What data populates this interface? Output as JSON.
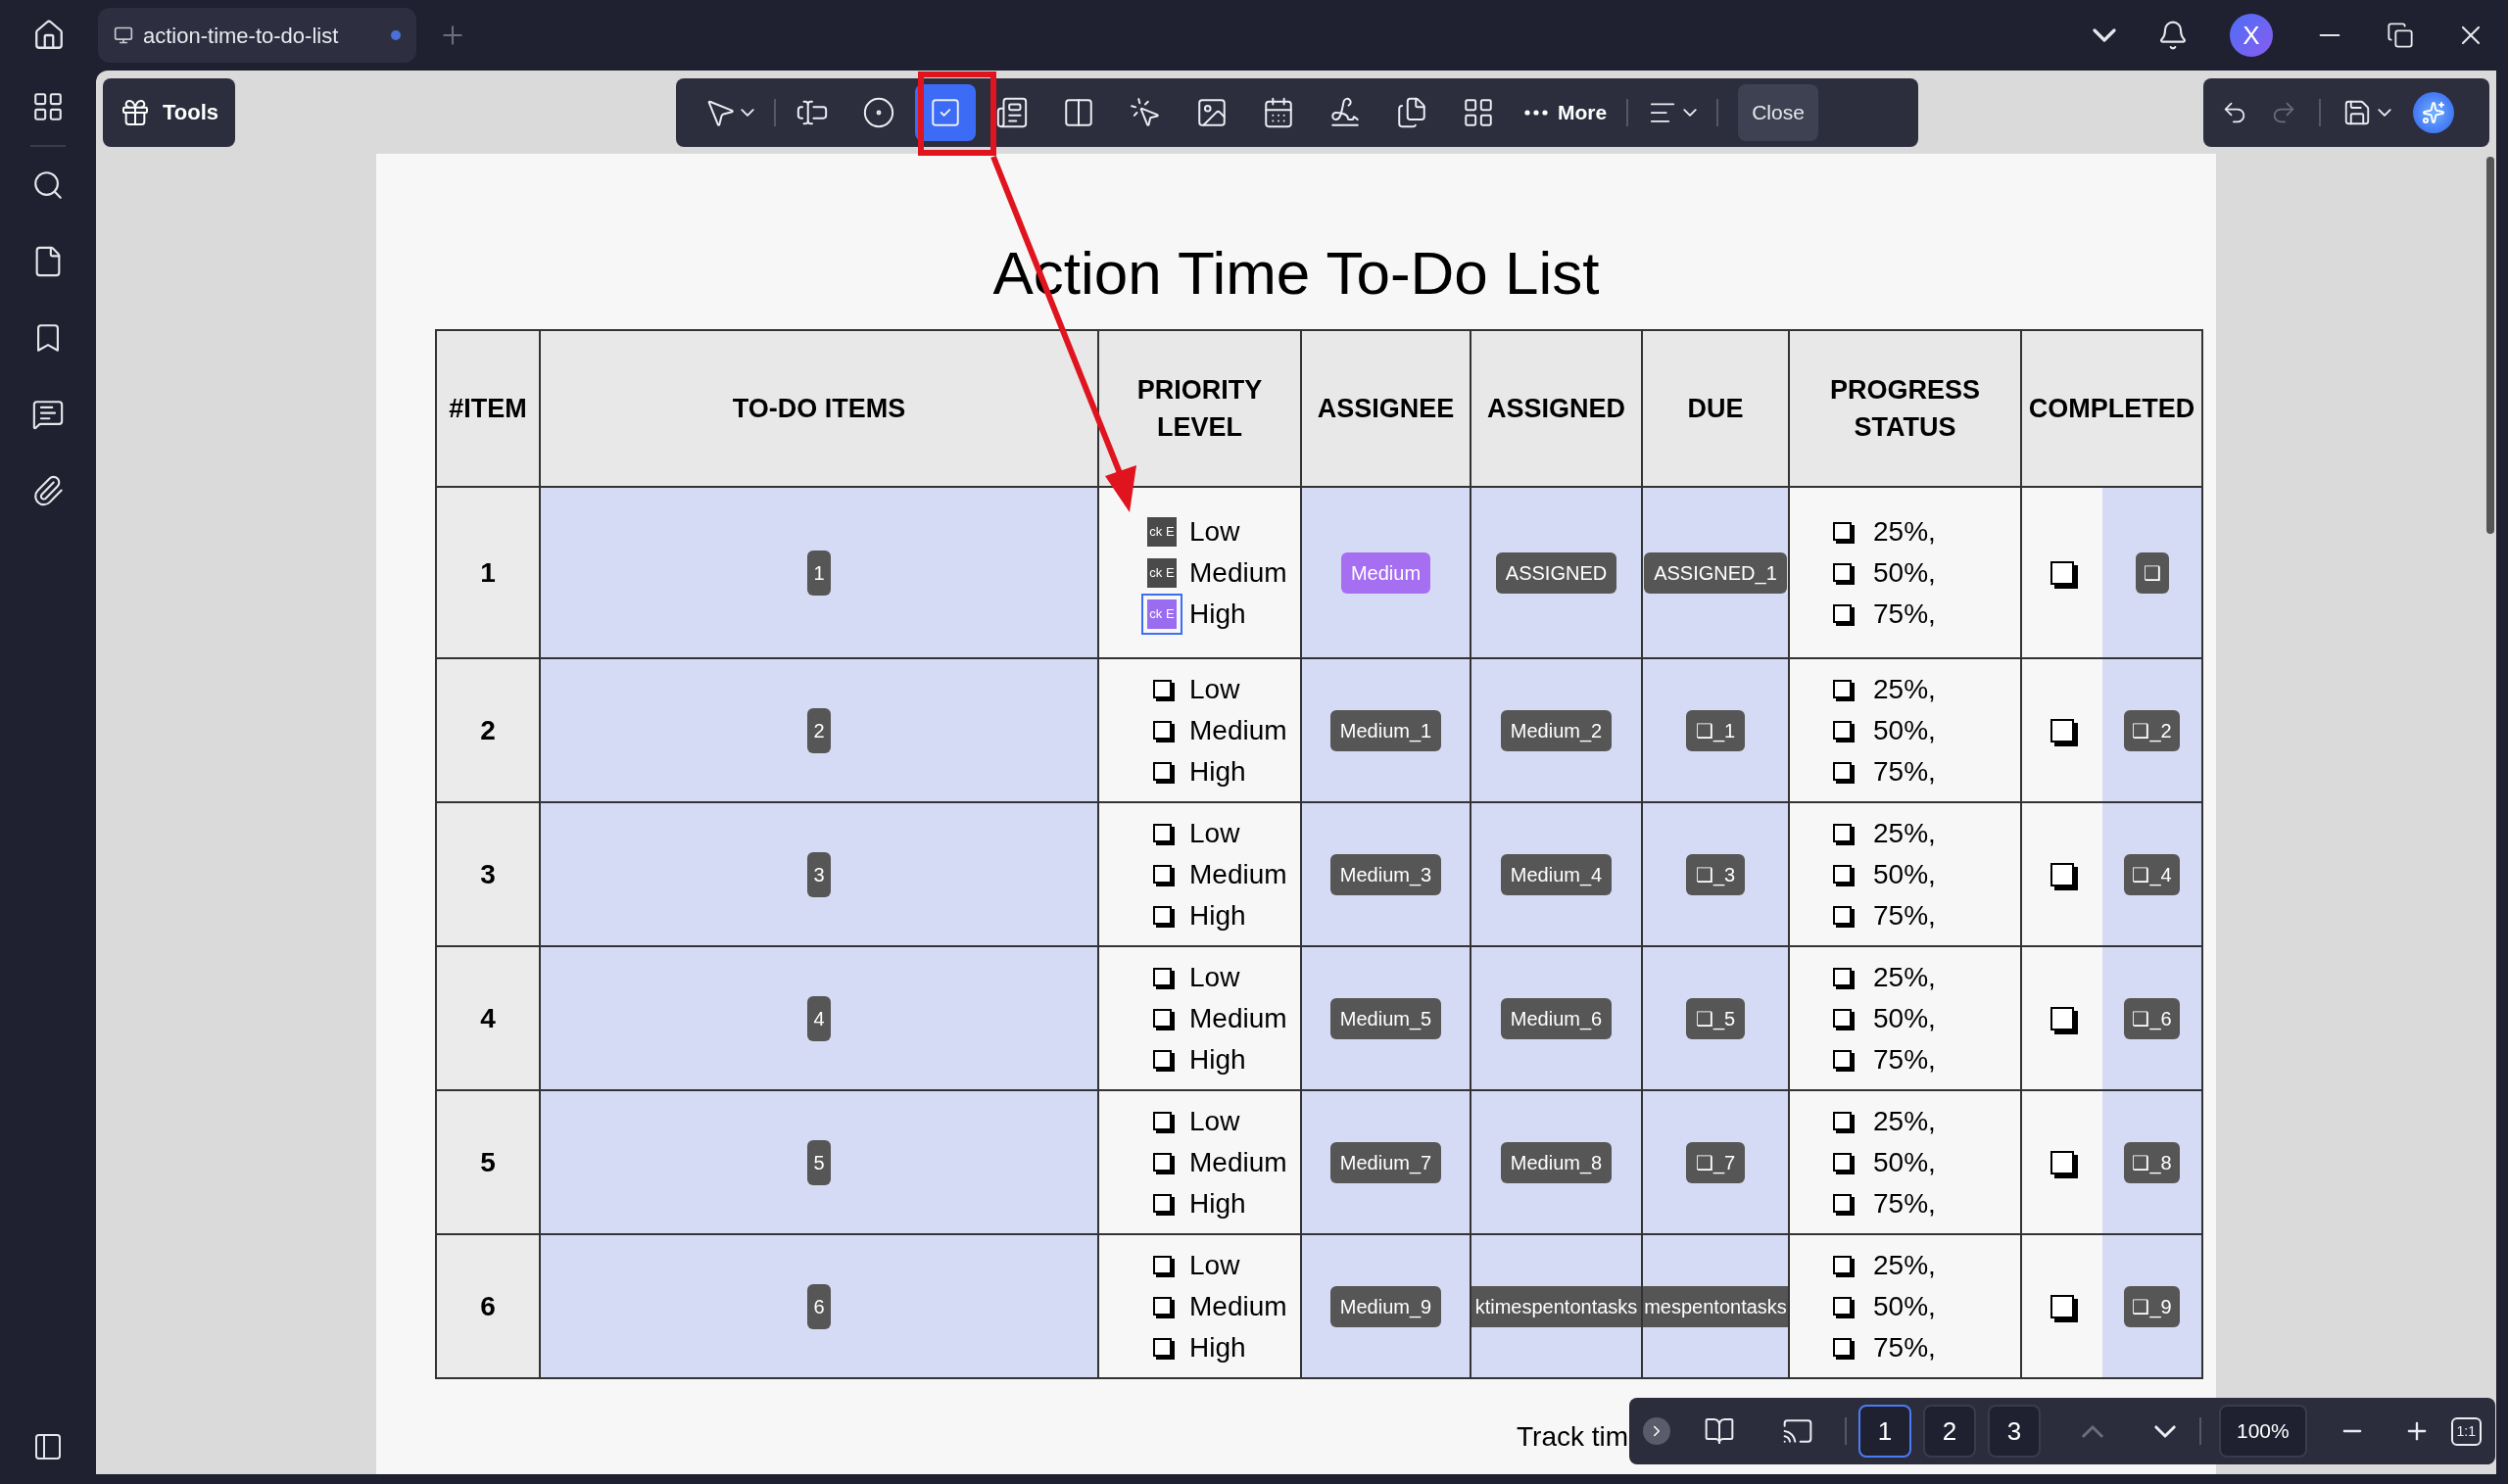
{
  "tab": {
    "title": "action-time-to-do-list",
    "unsaved": true
  },
  "user": {
    "initial": "X"
  },
  "toolbar": {
    "tools_label": "Tools",
    "more_label": "More",
    "close_label": "Close",
    "tools": [
      {
        "kind": "select",
        "selected": false
      },
      {
        "kind": "text-field",
        "selected": false
      },
      {
        "kind": "radio",
        "selected": false
      },
      {
        "kind": "checkbox",
        "selected": true
      },
      {
        "kind": "combo",
        "selected": false
      },
      {
        "kind": "list",
        "selected": false
      },
      {
        "kind": "button",
        "selected": false
      },
      {
        "kind": "image",
        "selected": false
      },
      {
        "kind": "date",
        "selected": false
      },
      {
        "kind": "signature",
        "selected": false
      },
      {
        "kind": "duplicate",
        "selected": false
      },
      {
        "kind": "grid",
        "selected": false
      }
    ]
  },
  "document": {
    "title": "Action Time To-Do List",
    "footer_text": "Track tim",
    "table": {
      "columns": [
        "#ITEM",
        "TO-DO ITEMS",
        "PRIORITY LEVEL",
        "ASSIGNEE",
        "ASSIGNED",
        "DUE",
        "PROGRESS STATUS",
        "COMPLETED"
      ],
      "rows": [
        {
          "item": "1",
          "todo": "1",
          "priority": [
            {
              "label": "Low",
              "kind": "field",
              "text": "ck E",
              "selected": false
            },
            {
              "label": "Medium",
              "kind": "field",
              "text": "ck E",
              "selected": false
            },
            {
              "label": "High",
              "kind": "field",
              "text": "ck E",
              "selected": true
            }
          ],
          "assignee": {
            "text": "Medium",
            "highlighted": true,
            "clipped": false
          },
          "assigned": {
            "text": "ASSIGNED",
            "highlighted": false,
            "clipped": false
          },
          "due": {
            "text": "ASSIGNED_1",
            "highlighted": false,
            "clipped": false
          },
          "progress": [
            {
              "label": "25%,",
              "checked": false
            },
            {
              "label": "50%,",
              "checked": false
            },
            {
              "label": "75%,",
              "checked": false
            }
          ],
          "completed": {
            "checked": false,
            "field": "❑"
          }
        },
        {
          "item": "2",
          "todo": "2",
          "priority": [
            {
              "label": "Low",
              "kind": "checkbox",
              "checked": false
            },
            {
              "label": "Medium",
              "kind": "checkbox",
              "checked": false
            },
            {
              "label": "High",
              "kind": "checkbox",
              "checked": false
            }
          ],
          "assignee": {
            "text": "Medium_1",
            "highlighted": false,
            "clipped": false
          },
          "assigned": {
            "text": "Medium_2",
            "highlighted": false,
            "clipped": false
          },
          "due": {
            "text": "❑_1",
            "highlighted": false,
            "clipped": false
          },
          "progress": [
            {
              "label": "25%,",
              "checked": false
            },
            {
              "label": "50%,",
              "checked": false
            },
            {
              "label": "75%,",
              "checked": false
            }
          ],
          "completed": {
            "checked": false,
            "field": "❑_2"
          }
        },
        {
          "item": "3",
          "todo": "3",
          "priority": [
            {
              "label": "Low",
              "kind": "checkbox",
              "checked": false
            },
            {
              "label": "Medium",
              "kind": "checkbox",
              "checked": false
            },
            {
              "label": "High",
              "kind": "checkbox",
              "checked": false
            }
          ],
          "assignee": {
            "text": "Medium_3",
            "highlighted": false,
            "clipped": false
          },
          "assigned": {
            "text": "Medium_4",
            "highlighted": false,
            "clipped": false
          },
          "due": {
            "text": "❑_3",
            "highlighted": false,
            "clipped": false
          },
          "progress": [
            {
              "label": "25%,",
              "checked": false
            },
            {
              "label": "50%,",
              "checked": false
            },
            {
              "label": "75%,",
              "checked": false
            }
          ],
          "completed": {
            "checked": false,
            "field": "❑_4"
          }
        },
        {
          "item": "4",
          "todo": "4",
          "priority": [
            {
              "label": "Low",
              "kind": "checkbox",
              "checked": false
            },
            {
              "label": "Medium",
              "kind": "checkbox",
              "checked": false
            },
            {
              "label": "High",
              "kind": "checkbox",
              "checked": false
            }
          ],
          "assignee": {
            "text": "Medium_5",
            "highlighted": false,
            "clipped": false
          },
          "assigned": {
            "text": "Medium_6",
            "highlighted": false,
            "clipped": false
          },
          "due": {
            "text": "❑_5",
            "highlighted": false,
            "clipped": false
          },
          "progress": [
            {
              "label": "25%,",
              "checked": false
            },
            {
              "label": "50%,",
              "checked": false
            },
            {
              "label": "75%,",
              "checked": false
            }
          ],
          "completed": {
            "checked": false,
            "field": "❑_6"
          }
        },
        {
          "item": "5",
          "todo": "5",
          "priority": [
            {
              "label": "Low",
              "kind": "checkbox",
              "checked": false
            },
            {
              "label": "Medium",
              "kind": "checkbox",
              "checked": false
            },
            {
              "label": "High",
              "kind": "checkbox",
              "checked": false
            }
          ],
          "assignee": {
            "text": "Medium_7",
            "highlighted": false,
            "clipped": false
          },
          "assigned": {
            "text": "Medium_8",
            "highlighted": false,
            "clipped": false
          },
          "due": {
            "text": "❑_7",
            "highlighted": false,
            "clipped": false
          },
          "progress": [
            {
              "label": "25%,",
              "checked": false
            },
            {
              "label": "50%,",
              "checked": false
            },
            {
              "label": "75%,",
              "checked": false
            }
          ],
          "completed": {
            "checked": false,
            "field": "❑_8"
          }
        },
        {
          "item": "6",
          "todo": "6",
          "priority": [
            {
              "label": "Low",
              "kind": "checkbox",
              "checked": false
            },
            {
              "label": "Medium",
              "kind": "checkbox",
              "checked": false
            },
            {
              "label": "High",
              "kind": "checkbox",
              "checked": false
            }
          ],
          "assignee": {
            "text": "Medium_9",
            "highlighted": false,
            "clipped": false
          },
          "assigned": {
            "text": "ktimespentontasks",
            "highlighted": false,
            "clipped": true
          },
          "due": {
            "text": "mespentontasks",
            "highlighted": false,
            "clipped": true
          },
          "progress": [
            {
              "label": "25%,",
              "checked": false
            },
            {
              "label": "50%,",
              "checked": false
            },
            {
              "label": "75%,",
              "checked": false
            }
          ],
          "completed": {
            "checked": false,
            "field": "❑_9"
          }
        }
      ]
    }
  },
  "pager": {
    "pages": [
      {
        "label": "1",
        "selected": true
      },
      {
        "label": "2",
        "selected": false
      },
      {
        "label": "3",
        "selected": false
      }
    ],
    "zoom": "100%",
    "actual_size": "1:1"
  }
}
